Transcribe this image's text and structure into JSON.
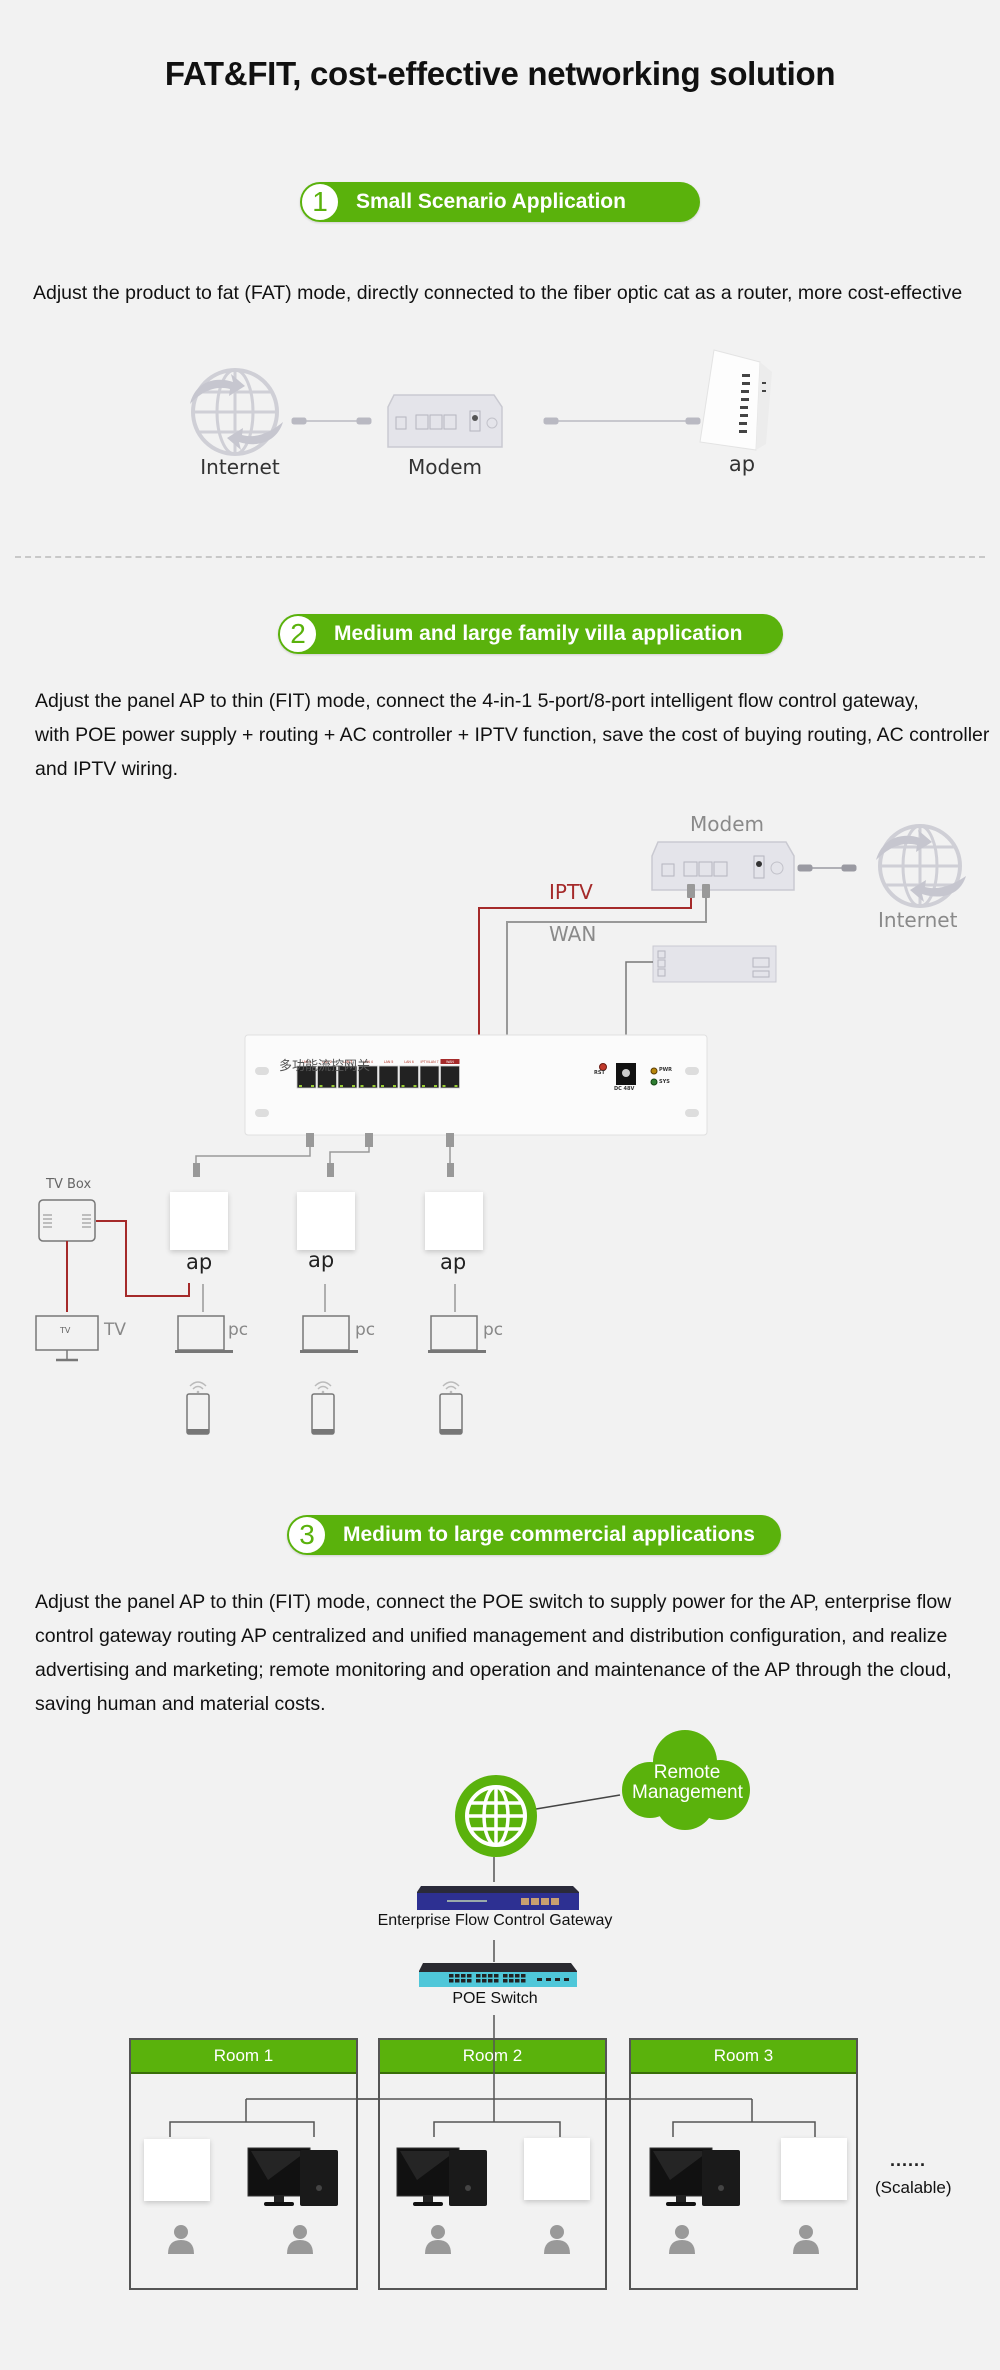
{
  "page": {
    "title": "FAT&FIT, cost-effective networking solution",
    "accent_color": "#5ab20c",
    "iptv_line_color": "#a52a2a"
  },
  "sections": [
    {
      "number": "1",
      "heading": "Small Scenario Application",
      "description": "Adjust the product to fat (FAT) mode, directly connected to the fiber optic cat as a router, more cost-effective",
      "diagram": {
        "labels": {
          "internet": "Internet",
          "modem": "Modem",
          "ap": "ap"
        }
      }
    },
    {
      "number": "2",
      "heading": "Medium and large family villa application",
      "description_lines": [
        "Adjust the panel AP to thin (FIT) mode, connect the 4-in-1 5-port/8-port intelligent flow control gateway,",
        "with POE power supply + routing + AC controller + IPTV function, save the cost of buying routing, AC controller",
        "and IPTV wiring."
      ],
      "diagram": {
        "labels": {
          "modem": "Modem",
          "internet": "Internet",
          "iptv": "IPTV",
          "wan": "WAN",
          "gateway_name": "多功能流控网关",
          "tv_box": "TV Box",
          "tv": "TV",
          "tv_screen": "TV",
          "ap": "ap",
          "pc": "pc",
          "rst": "RST",
          "dc": "DC 48V",
          "pwr": "PWR",
          "sys": "SYS"
        },
        "ports": [
          "LAN 1",
          "LAN 2",
          "LAN 3",
          "LAN 4",
          "LAN 5",
          "LAN 6",
          "IPTV/LAN 7",
          "WAN"
        ],
        "ap_count": 3
      }
    },
    {
      "number": "3",
      "heading": "Medium to large commercial applications",
      "description_lines": [
        "Adjust the panel AP to thin (FIT) mode, connect the POE switch to supply power for the AP, enterprise flow",
        "control gateway routing AP centralized and unified management and distribution configuration, and realize",
        "advertising and marketing; remote monitoring and operation and maintenance of the AP through the cloud,",
        "saving human and material costs."
      ],
      "diagram": {
        "cloud_line1": "Remote",
        "cloud_line2": "Management",
        "gateway": "Enterprise Flow Control Gateway",
        "switch": "POE Switch",
        "rooms": [
          "Room 1",
          "Room 2",
          "Room 3"
        ],
        "ellipsis": "......",
        "scalable": "(Scalable)"
      }
    }
  ]
}
